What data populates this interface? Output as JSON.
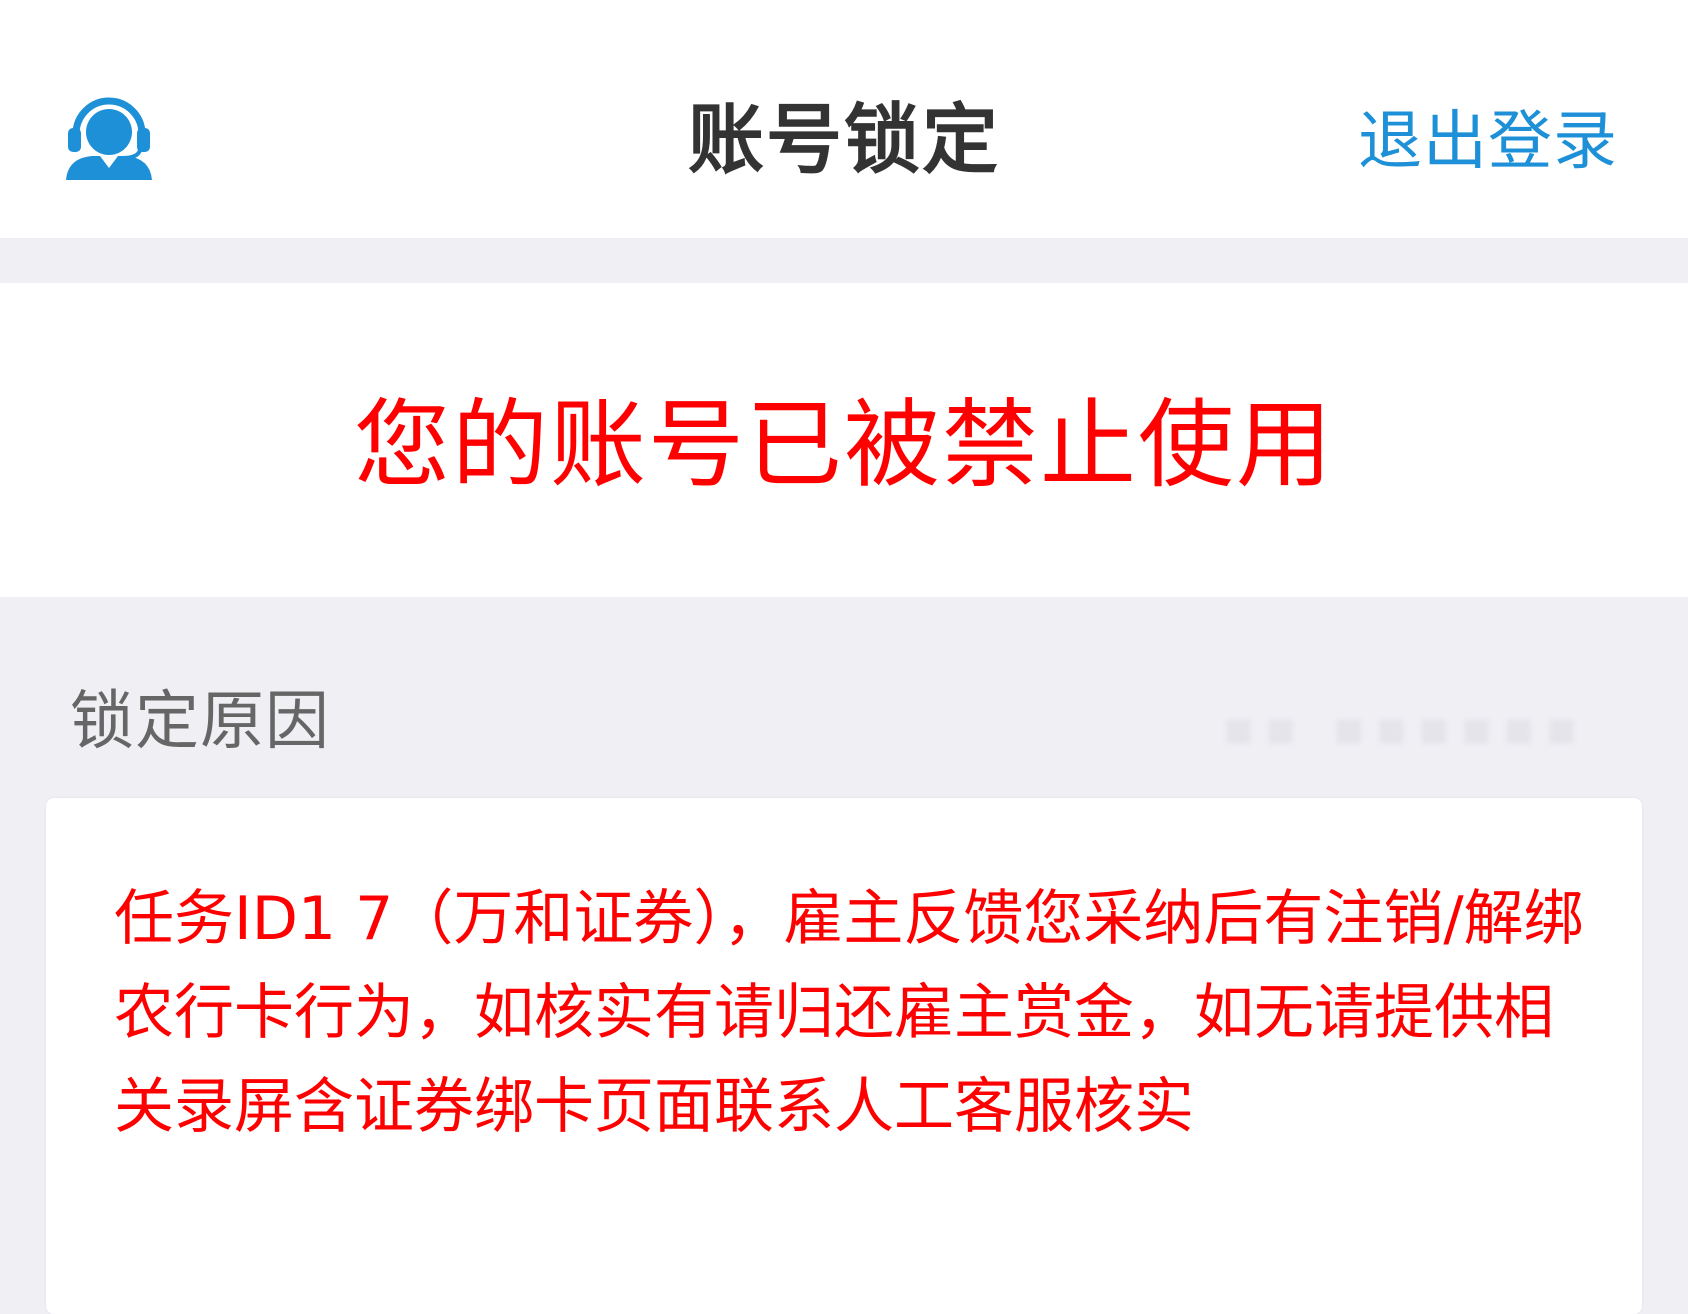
{
  "header": {
    "title": "账号锁定",
    "logout_label": "退出登录",
    "customer_service_icon": "customer-service-headset-icon",
    "accent_color": "#1e90d8"
  },
  "banner": {
    "message": "您的账号已被禁止使用",
    "color": "#ff0000"
  },
  "lock_reason": {
    "label": "锁定原因",
    "text": "任务ID1          7（万和证券），雇主反馈您采纳后有注销/解绑农行卡行为，如核实有请归还雇主赏金，如无请提供相关录屏含证券绑卡页面联系人工客服核实"
  }
}
